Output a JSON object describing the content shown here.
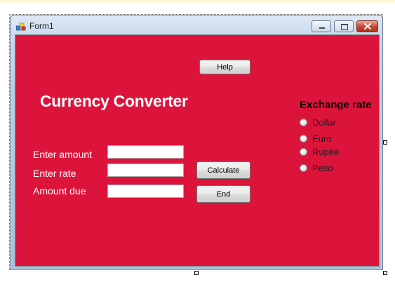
{
  "window": {
    "title": "Form1",
    "background_color": "#DC143C",
    "icons": {
      "app": "form-app-icon",
      "minimize": "minimize-icon",
      "maximize": "maximize-icon",
      "close": "close-icon"
    }
  },
  "form": {
    "help_button": "Help",
    "heading": "Currency Converter",
    "labels": {
      "enter_amount": "Enter amount",
      "enter_rate": "Enter rate",
      "amount_due": "Amount due"
    },
    "inputs": {
      "amount": "",
      "rate": "",
      "amount_due": ""
    },
    "calculate_button": "Calculate",
    "end_button": "End"
  },
  "exchange": {
    "title": "Exchange rate",
    "options": [
      "Dollar",
      "Euro",
      "Rupee",
      "Peso"
    ],
    "selected": null
  }
}
